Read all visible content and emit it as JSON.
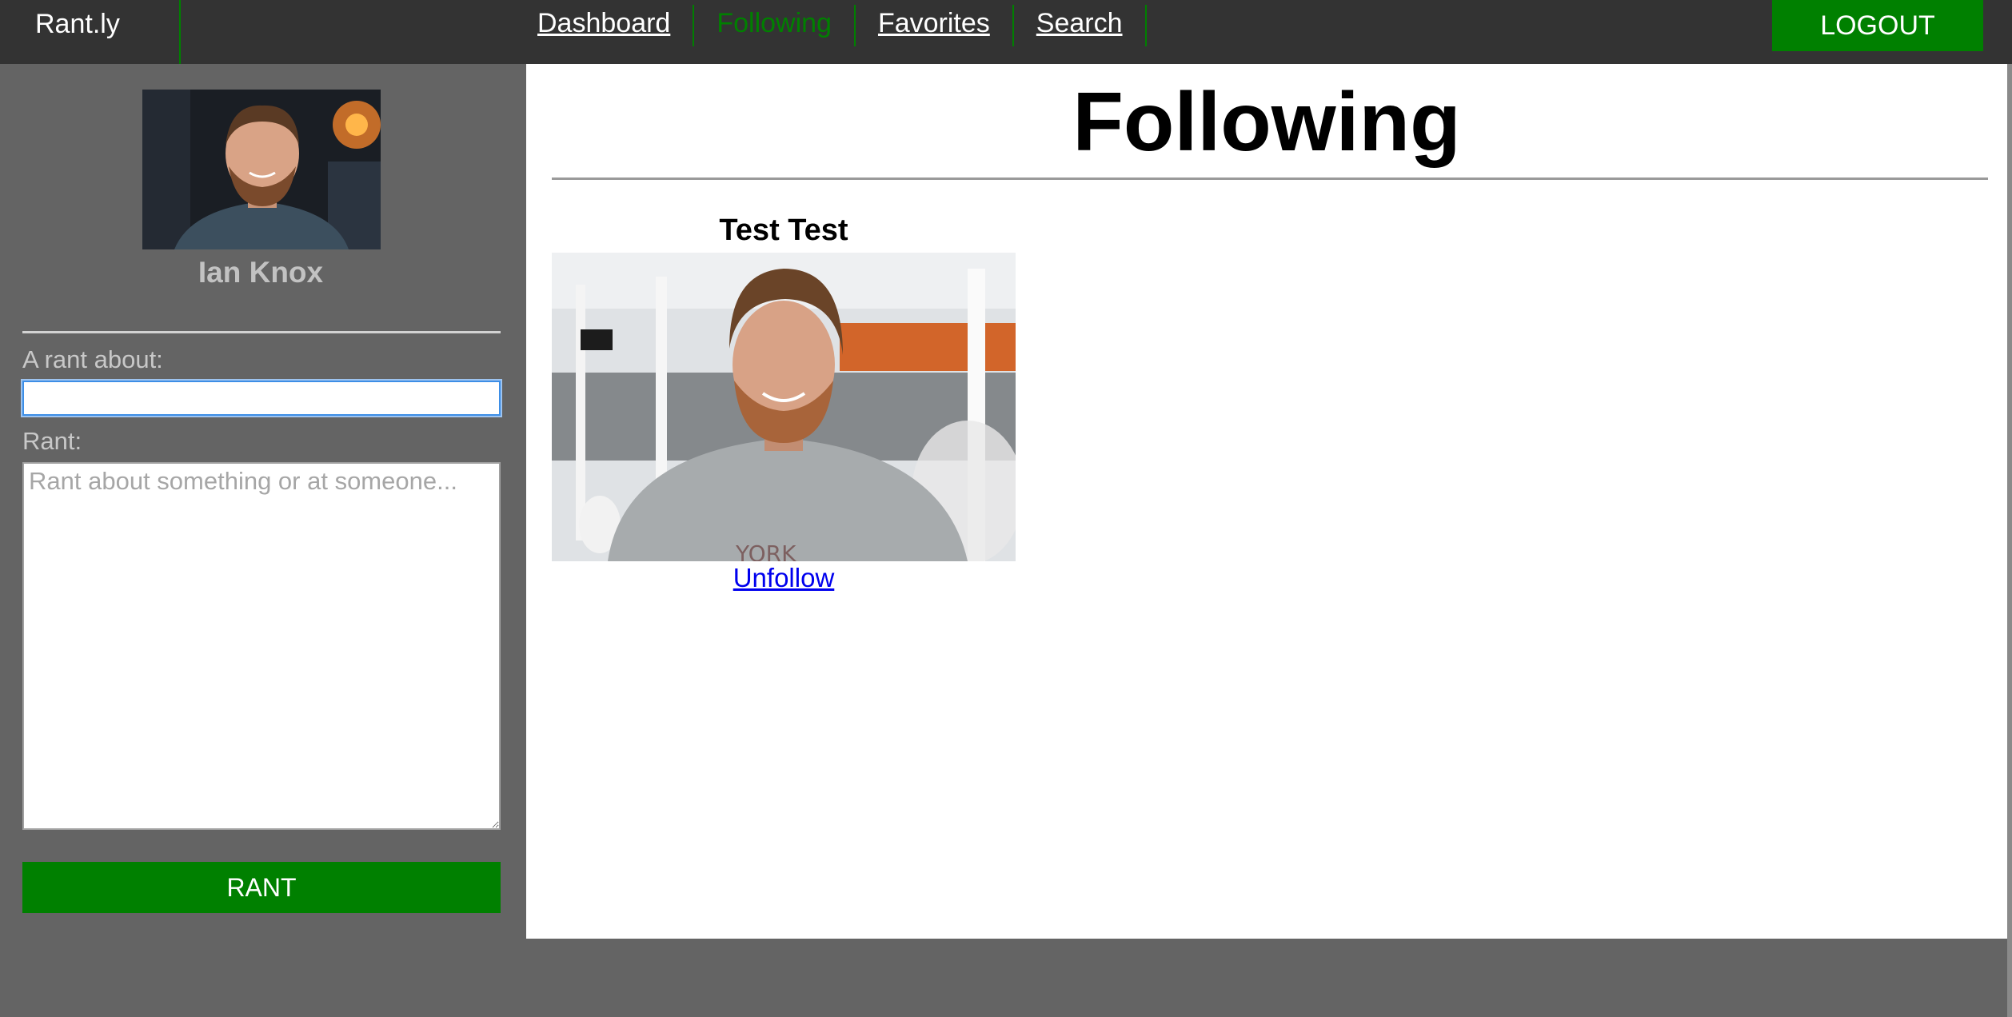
{
  "brand": "Rant.ly",
  "nav": {
    "links": [
      {
        "label": "Dashboard",
        "active": false
      },
      {
        "label": "Following",
        "active": true
      },
      {
        "label": "Favorites",
        "active": false
      },
      {
        "label": "Search",
        "active": false
      }
    ],
    "logout_label": "LOGOUT"
  },
  "sidebar": {
    "user_name": "Ian Knox",
    "about_label": "A rant about:",
    "about_value": "",
    "rant_label": "Rant:",
    "rant_placeholder": "Rant about something or at someone...",
    "submit_label": "RANT"
  },
  "main": {
    "title": "Following",
    "following": [
      {
        "name": "Test Test",
        "action_label": "Unfollow"
      }
    ]
  },
  "colors": {
    "nav_bg": "#333333",
    "page_bg": "#646464",
    "accent": "#008000",
    "link": "#0000ee"
  }
}
